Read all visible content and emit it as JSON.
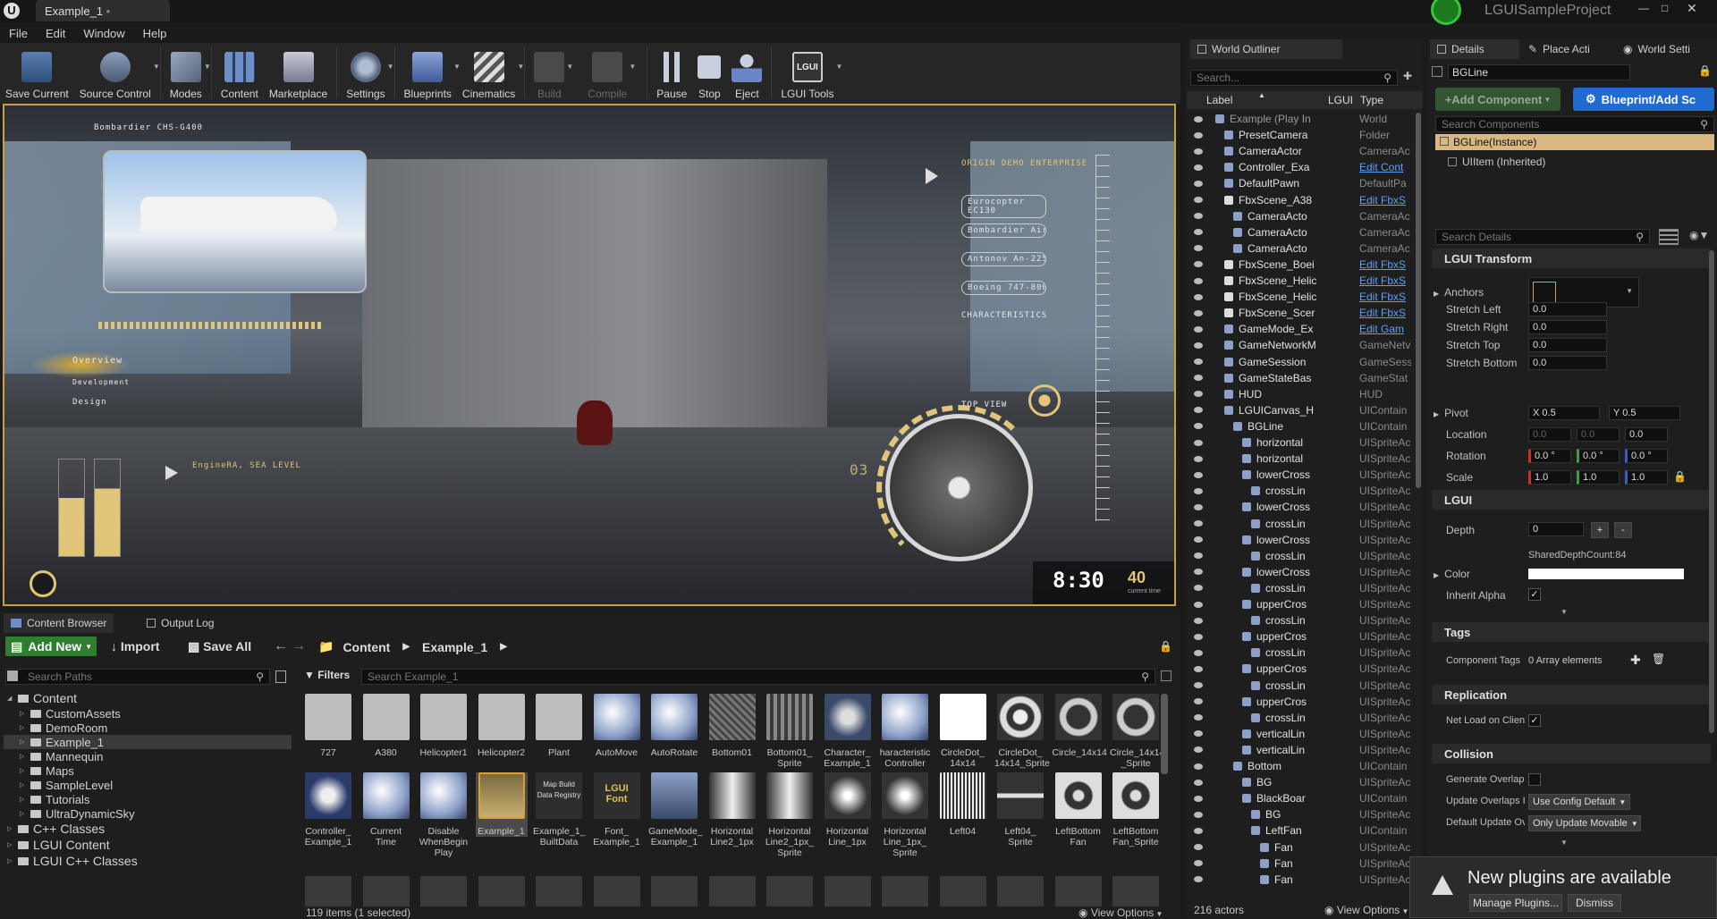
{
  "title_tab": "Example_1",
  "project_name": "LGUISampleProject",
  "menu": [
    "File",
    "Edit",
    "Window",
    "Help"
  ],
  "toolbar": [
    {
      "label": "Save Current",
      "icon": "save-icon",
      "enabled": true
    },
    {
      "label": "Source Control",
      "icon": "source-control-icon",
      "enabled": true
    },
    {
      "label": "Modes",
      "icon": "modes-icon",
      "enabled": true
    },
    {
      "label": "Content",
      "icon": "content-icon",
      "enabled": true
    },
    {
      "label": "Marketplace",
      "icon": "marketplace-icon",
      "enabled": true
    },
    {
      "label": "Settings",
      "icon": "settings-icon",
      "enabled": true
    },
    {
      "label": "Blueprints",
      "icon": "blueprints-icon",
      "enabled": true
    },
    {
      "label": "Cinematics",
      "icon": "cinematics-icon",
      "enabled": true
    },
    {
      "label": "Build",
      "icon": "build-icon",
      "enabled": false
    },
    {
      "label": "Compile",
      "icon": "compile-icon",
      "enabled": false
    },
    {
      "label": "Pause",
      "icon": "pause-icon",
      "enabled": true
    },
    {
      "label": "Stop",
      "icon": "stop-icon",
      "enabled": true
    },
    {
      "label": "Eject",
      "icon": "eject-icon",
      "enabled": true
    },
    {
      "label": "LGUI Tools",
      "icon": "lgui-tools-icon",
      "enabled": true
    }
  ],
  "viewport": {
    "aircraft": "Bombardier CHS-G400",
    "demo_title": "ORIGIN DEMO ENTERPRISE",
    "list": [
      "Eurocopter EC130",
      "Bombardier Aircraft",
      "Antonov An-225",
      "Boeing 747-800"
    ],
    "characteristics": "CHARACTERISTICS",
    "overview": "Overview",
    "development": "Development",
    "design": "Design",
    "engine": "EngineRA, SEA LEVEL",
    "top_view": "TOP VIEW",
    "counter": "03",
    "time": "8:30",
    "frame": "40",
    "frame_sub": "current time"
  },
  "content_browser": {
    "tabs": [
      "Content Browser",
      "Output Log"
    ],
    "add_new": "Add New",
    "import": "Import",
    "save_all": "Save All",
    "path": [
      "Content",
      "Example_1"
    ],
    "search_paths": "Search Paths",
    "filters": "Filters",
    "search_assets": "Search Example_1",
    "tree": [
      {
        "label": "Content",
        "level": 0
      },
      {
        "label": "CustomAssets",
        "level": 1
      },
      {
        "label": "DemoRoom",
        "level": 1
      },
      {
        "label": "Example_1",
        "level": 1
      },
      {
        "label": "Mannequin",
        "level": 1
      },
      {
        "label": "Maps",
        "level": 1
      },
      {
        "label": "SampleLevel",
        "level": 1
      },
      {
        "label": "Tutorials",
        "level": 1
      },
      {
        "label": "UltraDynamicSky",
        "level": 1
      },
      {
        "label": "C++ Classes",
        "level": 0
      },
      {
        "label": "LGUI Content",
        "level": 0
      },
      {
        "label": "LGUI C++ Classes",
        "level": 0
      }
    ],
    "assets_row1": [
      "727",
      "A380",
      "Helicopter1",
      "Helicopter2",
      "Plant",
      "AutoMove",
      "AutoRotate",
      "Bottom01",
      "Bottom01_\nSprite",
      "Character_\nExample_1",
      "haracteristic\nController",
      "CircleDot_\n14x14",
      "CircleDot_\n14x14_Sprite",
      "Circle_14x14",
      "Circle_14x14\n_Sprite"
    ],
    "assets_row2": [
      "Controller_\nExample_1",
      "Current\nTime",
      "Disable\nWhenBegin\nPlay",
      "Example_1",
      "Example_1_\nBuiltData",
      "Font_\nExample_1",
      "GameMode_\nExample_1",
      "Horizontal\nLine2_1px",
      "Horizontal\nLine2_1px_\nSprite",
      "Horizontal\nLine_1px",
      "Horizontal\nLine_1px_\nSprite",
      "Left04",
      "Left04_\nSprite",
      "LeftBottom\nFan",
      "LeftBottom\nFan_Sprite"
    ],
    "thumb_texts": {
      "map_build": "Map Build Data Registry",
      "font": "LGUI Font"
    },
    "status": "119 items (1 selected)",
    "view_options": "View Options"
  },
  "outliner": {
    "tab": "World Outliner",
    "search": "Search...",
    "col_label": "Label",
    "col_lgui": "LGUI",
    "col_type": "Type",
    "rows": [
      {
        "label": "Example (Play In",
        "type": "World",
        "indent": 0,
        "link": false
      },
      {
        "label": "PresetCamera",
        "type": "Folder",
        "indent": 1,
        "link": false
      },
      {
        "label": "CameraActor",
        "type": "CameraAc",
        "indent": 1,
        "link": false
      },
      {
        "label": "Controller_Exa",
        "type": "Edit Cont",
        "indent": 1,
        "link": true
      },
      {
        "label": "DefaultPawn",
        "type": "DefaultPa",
        "indent": 1,
        "link": false
      },
      {
        "label": "FbxScene_A38",
        "type": "Edit FbxS",
        "indent": 1,
        "link": true
      },
      {
        "label": "CameraActo",
        "type": "CameraAc",
        "indent": 2,
        "link": false
      },
      {
        "label": "CameraActo",
        "type": "CameraAc",
        "indent": 2,
        "link": false
      },
      {
        "label": "CameraActo",
        "type": "CameraAc",
        "indent": 2,
        "link": false
      },
      {
        "label": "FbxScene_Boei",
        "type": "Edit FbxS",
        "indent": 1,
        "link": true
      },
      {
        "label": "FbxScene_Helic",
        "type": "Edit FbxS",
        "indent": 1,
        "link": true
      },
      {
        "label": "FbxScene_Helic",
        "type": "Edit FbxS",
        "indent": 1,
        "link": true
      },
      {
        "label": "FbxScene_Scer",
        "type": "Edit FbxS",
        "indent": 1,
        "link": true
      },
      {
        "label": "GameMode_Ex",
        "type": "Edit Gam",
        "indent": 1,
        "link": true
      },
      {
        "label": "GameNetworkM",
        "type": "GameNetv",
        "indent": 1,
        "link": false
      },
      {
        "label": "GameSession",
        "type": "GameSess",
        "indent": 1,
        "link": false
      },
      {
        "label": "GameStateBas",
        "type": "GameStat",
        "indent": 1,
        "link": false
      },
      {
        "label": "HUD",
        "type": "HUD",
        "indent": 1,
        "link": false
      },
      {
        "label": "LGUICanvas_H",
        "type": "UIContain",
        "indent": 1,
        "link": false
      },
      {
        "label": "BGLine",
        "type": "UIContain",
        "indent": 2,
        "link": false
      },
      {
        "label": "horizontal",
        "type": "UISpriteAc",
        "indent": 3,
        "link": false
      },
      {
        "label": "horizontal",
        "type": "UISpriteAc",
        "indent": 3,
        "link": false
      },
      {
        "label": "lowerCross",
        "type": "UISpriteAc",
        "indent": 3,
        "link": false
      },
      {
        "label": "crossLin",
        "type": "UISpriteAc",
        "indent": 4,
        "link": false
      },
      {
        "label": "lowerCross",
        "type": "UISpriteAc",
        "indent": 3,
        "link": false
      },
      {
        "label": "crossLin",
        "type": "UISpriteAc",
        "indent": 4,
        "link": false
      },
      {
        "label": "lowerCross",
        "type": "UISpriteAc",
        "indent": 3,
        "link": false
      },
      {
        "label": "crossLin",
        "type": "UISpriteAc",
        "indent": 4,
        "link": false
      },
      {
        "label": "lowerCross",
        "type": "UISpriteAc",
        "indent": 3,
        "link": false
      },
      {
        "label": "crossLin",
        "type": "UISpriteAc",
        "indent": 4,
        "link": false
      },
      {
        "label": "upperCros",
        "type": "UISpriteAc",
        "indent": 3,
        "link": false
      },
      {
        "label": "crossLin",
        "type": "UISpriteAc",
        "indent": 4,
        "link": false
      },
      {
        "label": "upperCros",
        "type": "UISpriteAc",
        "indent": 3,
        "link": false
      },
      {
        "label": "crossLin",
        "type": "UISpriteAc",
        "indent": 4,
        "link": false
      },
      {
        "label": "upperCros",
        "type": "UISpriteAc",
        "indent": 3,
        "link": false
      },
      {
        "label": "crossLin",
        "type": "UISpriteAc",
        "indent": 4,
        "link": false
      },
      {
        "label": "upperCros",
        "type": "UISpriteAc",
        "indent": 3,
        "link": false
      },
      {
        "label": "crossLin",
        "type": "UISpriteAc",
        "indent": 4,
        "link": false
      },
      {
        "label": "verticalLin",
        "type": "UISpriteAc",
        "indent": 3,
        "link": false
      },
      {
        "label": "verticalLin",
        "type": "UISpriteAc",
        "indent": 3,
        "link": false
      },
      {
        "label": "Bottom",
        "type": "UIContain",
        "indent": 2,
        "link": false
      },
      {
        "label": "BG",
        "type": "UISpriteAc",
        "indent": 3,
        "link": false
      },
      {
        "label": "BlackBoar",
        "type": "UIContain",
        "indent": 3,
        "link": false
      },
      {
        "label": "BG",
        "type": "UISpriteAc",
        "indent": 4,
        "link": false
      },
      {
        "label": "LeftFan",
        "type": "UIContain",
        "indent": 4,
        "link": false
      },
      {
        "label": "Fan",
        "type": "UISpriteAc",
        "indent": 5,
        "link": false
      },
      {
        "label": "Fan",
        "type": "UISpriteAc",
        "indent": 5,
        "link": false
      },
      {
        "label": "Fan",
        "type": "UISpriteAc",
        "indent": 5,
        "link": false
      }
    ],
    "count": "216 actors",
    "view_options": "View Options"
  },
  "details": {
    "tabs": [
      "Details",
      "Place Acti",
      "World Setti"
    ],
    "name": "BGLine",
    "add_component": "+Add Component",
    "blueprint": "Blueprint/Add Sc",
    "search_components": "Search Components",
    "instance": "BGLine(Instance)",
    "inherited": "UIItem (Inherited)",
    "search_details": "Search Details",
    "lgui_transform": "LGUI Transform",
    "anchors": "Anchors",
    "stretch": [
      {
        "label": "Stretch Left",
        "value": "0.0"
      },
      {
        "label": "Stretch Right",
        "value": "0.0"
      },
      {
        "label": "Stretch Top",
        "value": "0.0"
      },
      {
        "label": "Stretch Bottom",
        "value": "0.0"
      }
    ],
    "pivot": {
      "label": "Pivot",
      "x": "X 0.5",
      "y": "Y 0.5"
    },
    "location": {
      "label": "Location",
      "x": "0.0",
      "y": "0.0",
      "z": "0.0"
    },
    "rotation": {
      "label": "Rotation",
      "x": "0.0 °",
      "y": "0.0 °",
      "z": "0.0 °"
    },
    "scale": {
      "label": "Scale",
      "x": "1.0",
      "y": "1.0",
      "z": "1.0"
    },
    "lgui": "LGUI",
    "depth": {
      "label": "Depth",
      "value": "0"
    },
    "shared_depth": "SharedDepthCount:84",
    "color": "Color",
    "inherit_alpha": "Inherit Alpha",
    "tags": "Tags",
    "component_tags": "Component Tags",
    "array_elements": "0 Array elements",
    "replication": "Replication",
    "net_load": "Net Load on Clien",
    "collision": "Collision",
    "generate_overlap": "Generate Overlap",
    "update_overlaps": "Update Overlaps I",
    "update_overlaps_value": "Use Config Default",
    "default_update": "Default Update Ov",
    "default_update_value": "Only Update Movable"
  },
  "notification": {
    "text": "New plugins are available",
    "manage": "Manage Plugins...",
    "dismiss": "Dismiss"
  },
  "colors": {
    "accent_gold": "#c9a03a",
    "link_blue": "#5aa0ff",
    "selected": "#3a3a3a",
    "hud_gold": "#e0c57a"
  }
}
